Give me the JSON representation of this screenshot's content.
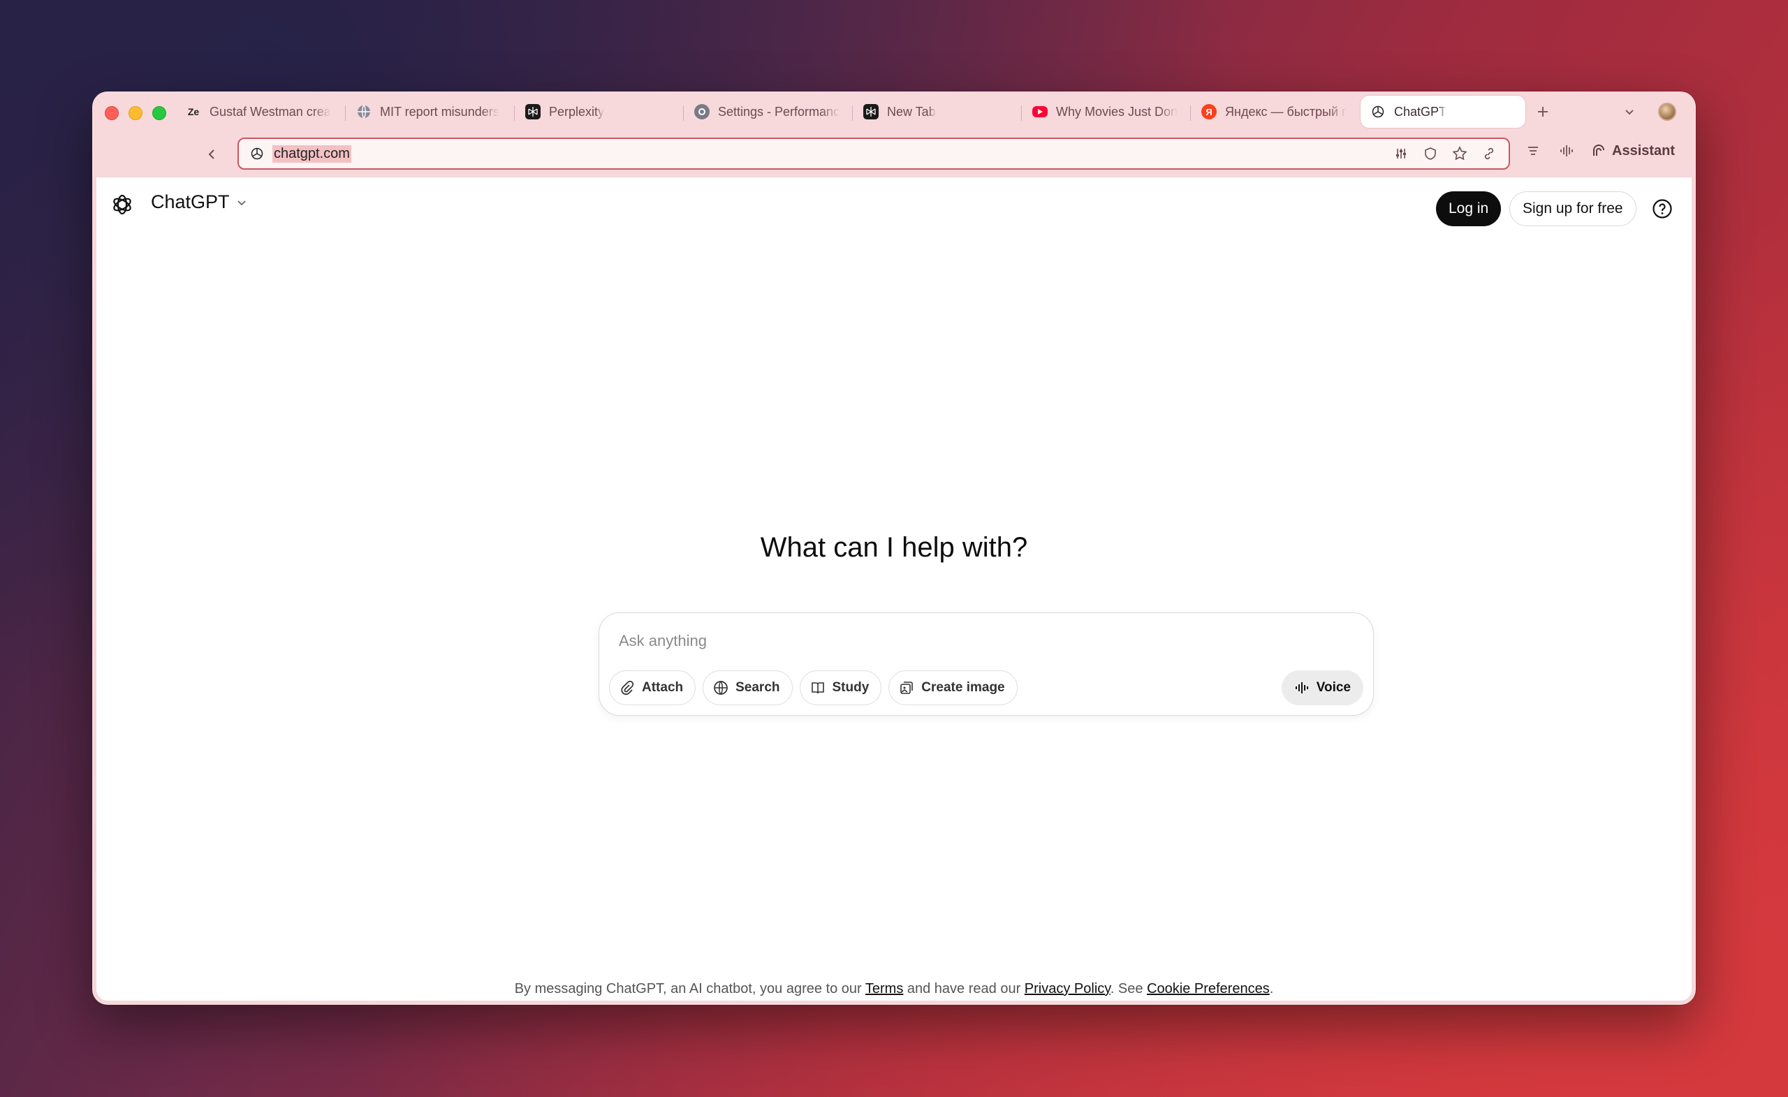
{
  "browser": {
    "tabs": [
      {
        "label": "Gustaf Westman crea",
        "icon": "zen-icon"
      },
      {
        "label": "MIT report misunders",
        "icon": "globe-icon"
      },
      {
        "label": "Perplexity",
        "icon": "perplexity-icon"
      },
      {
        "label": "Settings - Performanc",
        "icon": "settings-icon"
      },
      {
        "label": "New Tab",
        "icon": "perplexity-icon"
      },
      {
        "label": "Why Movies Just Don",
        "icon": "youtube-icon"
      },
      {
        "label": "Яндекс — быстрый п",
        "icon": "yandex-icon"
      },
      {
        "label": "ChatGPT",
        "icon": "openai-icon",
        "active": true
      }
    ],
    "url": "chatgpt.com",
    "assistant_label": "Assistant"
  },
  "header": {
    "model_name": "ChatGPT",
    "login_label": "Log in",
    "signup_label": "Sign up for free"
  },
  "main": {
    "title": "What can I help with?",
    "composer_placeholder": "Ask anything",
    "chips": {
      "attach": "Attach",
      "search": "Search",
      "study": "Study",
      "create_image": "Create image"
    },
    "voice_label": "Voice"
  },
  "footer": {
    "prefix": "By messaging ChatGPT, an AI chatbot, you agree to our ",
    "terms": "Terms",
    "middle": " and have read our ",
    "privacy": "Privacy Policy",
    "middle2": ". See ",
    "cookies": "Cookie Preferences",
    "suffix": "."
  }
}
